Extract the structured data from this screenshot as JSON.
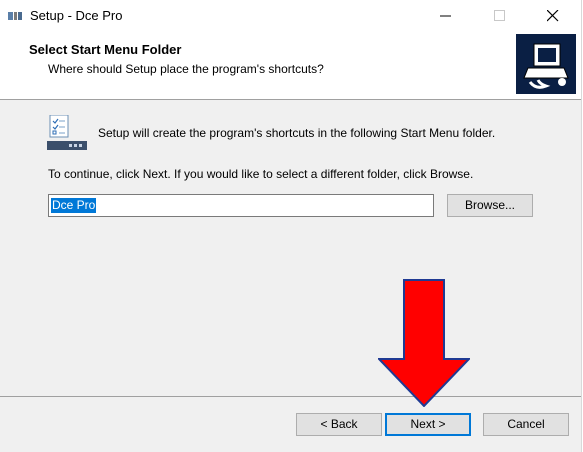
{
  "window": {
    "title": "Setup - Dce Pro"
  },
  "titlebar": {
    "minimize_icon": "minimize-icon",
    "maximize_icon": "maximize-icon",
    "close_icon": "close-icon"
  },
  "header": {
    "title": "Select Start Menu Folder",
    "subtitle": "Where should Setup place the program's shortcuts?",
    "image_icon": "setup-computer-icon"
  },
  "content": {
    "icon": "start-menu-folder-icon",
    "info_text": "Setup will create the program's shortcuts in the following Start Menu folder.",
    "continue_text": "To continue, click Next. If you would like to select a different folder, click Browse.",
    "folder_value": "Dce Pro",
    "browse_label": "Browse..."
  },
  "footer": {
    "back_label": "< Back",
    "next_label": "Next >",
    "cancel_label": "Cancel"
  },
  "overlay": {
    "arrow_icon": "down-arrow-icon",
    "arrow_color": "#ff0000"
  },
  "colors": {
    "selection": "#0078d7",
    "panel": "#f0f0f0",
    "button": "#e1e1e1"
  }
}
